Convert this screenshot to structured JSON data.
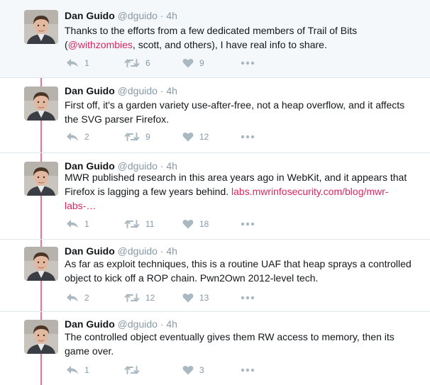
{
  "colors": {
    "thread_line": "#e8729b",
    "link": "#e0245e",
    "muted": "#8899a6"
  },
  "tweets": [
    {
      "name": "Dan Guido",
      "handle": "@dguido",
      "time": "4h",
      "text_parts": [
        "Thanks to the efforts from a few dedicated members of Trail of Bits (",
        "@withzombies",
        ", scott, and others), I have real info to share."
      ],
      "reply_count": "1",
      "retweet_count": "6",
      "like_count": "9"
    },
    {
      "name": "Dan Guido",
      "handle": "@dguido",
      "time": "4h",
      "text_parts": [
        "First off, it's a garden variety use-after-free, not a heap overflow, and it affects the SVG parser Firefox."
      ],
      "reply_count": "2",
      "retweet_count": "9",
      "like_count": "12"
    },
    {
      "name": "Dan Guido",
      "handle": "@dguido",
      "time": "4h",
      "text_parts": [
        "MWR published research in this area years ago in WebKit, and it appears that Firefox is lagging a few years behind. ",
        "labs.mwrinfosecurity.com/blog/mwr-labs-…"
      ],
      "reply_count": "1",
      "retweet_count": "11",
      "like_count": "18"
    },
    {
      "name": "Dan Guido",
      "handle": "@dguido",
      "time": "4h",
      "text_parts": [
        "As far as exploit techniques, this is a routine UAF that heap sprays a controlled object to kick off a ROP chain. Pwn2Own 2012-level tech."
      ],
      "reply_count": "2",
      "retweet_count": "12",
      "like_count": "13"
    },
    {
      "name": "Dan Guido",
      "handle": "@dguido",
      "time": "4h",
      "text_parts": [
        "The controlled object eventually gives them RW access to memory, then its game over."
      ],
      "reply_count": "1",
      "retweet_count": "",
      "like_count": "3"
    }
  ]
}
